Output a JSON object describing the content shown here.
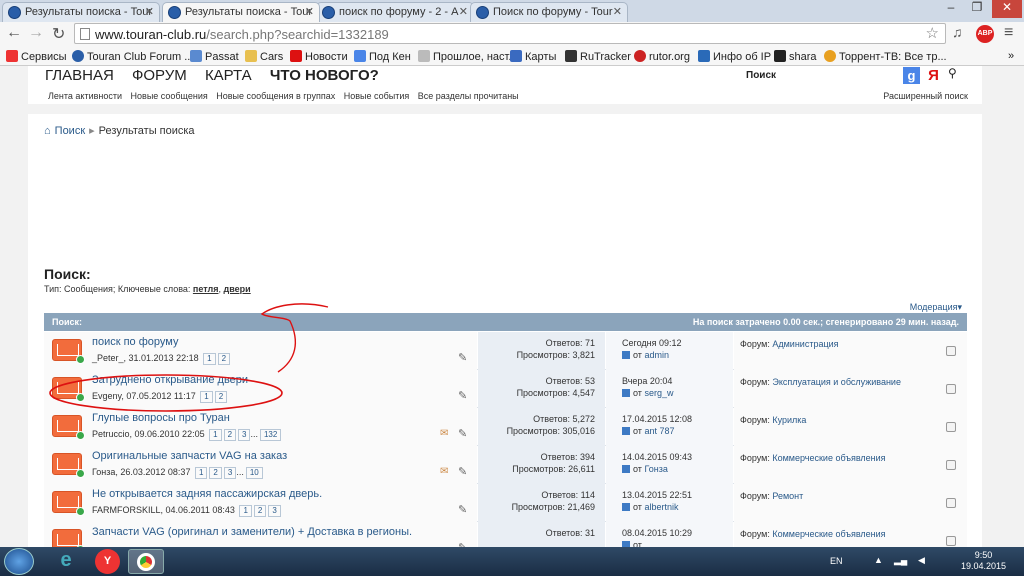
{
  "tabs": [
    {
      "title": "Результаты поиска - Tour"
    },
    {
      "title": "Результаты поиска - Tour"
    },
    {
      "title": "поиск по форуму - 2 - А"
    },
    {
      "title": "Поиск по форуму - Tour"
    }
  ],
  "address": {
    "host": "www.touran-club.ru",
    "path": "/search.php?searchid=1332189"
  },
  "bookmarks": [
    "Сервисы",
    "Touran Club Forum ...",
    "Passat",
    "Cars",
    "Новости",
    "Под Кен",
    "Прошлое, наст.",
    "Карты",
    "RuTracker",
    "rutor.org",
    "Инфо об IP",
    "shara",
    "Торрент-ТВ: Все тр..."
  ],
  "header": {
    "nav": [
      "ГЛАВНАЯ",
      "ФОРУМ",
      "КАРТА",
      "ЧТО НОВОГО?"
    ],
    "subnav": [
      "Лента активности",
      "Новые сообщения",
      "Новые сообщения в группах",
      "Новые события",
      "Все разделы прочитаны"
    ],
    "search_label": "Поиск",
    "advanced_search": "Расширенный поиск"
  },
  "breadcrumb": {
    "search": "Поиск",
    "current": "Результаты поиска"
  },
  "page": {
    "title": "Поиск:",
    "subtitle_prefix": "Тип: Сообщения; Ключевые слова:",
    "keyword1": "петля",
    "keyword2": "двери",
    "moderation": "Модерация",
    "table_title": "Поиск:",
    "table_info": "На поиск затрачено 0.00 сек.; сгенерировано 29 мин. назад."
  },
  "rows": [
    {
      "title": "поиск по форуму",
      "meta": "_Peter_, 31.01.2013 22:18",
      "pages": [
        "1",
        "2"
      ],
      "replies": "Ответов: 71",
      "views": "Просмотров: 3,821",
      "last_date": "Сегодня 09:12",
      "last_by": "admin",
      "forum": "Администрация"
    },
    {
      "title": "Затруднено открывание двери",
      "meta": "Evgeny, 07.05.2012 11:17",
      "pages": [
        "1",
        "2"
      ],
      "replies": "Ответов: 53",
      "views": "Просмотров: 4,547",
      "last_date": "Вчера 20:04",
      "last_by": "serg_w",
      "forum": "Эксплуатация и обслуживание"
    },
    {
      "title": "Глупые вопросы про Туран",
      "meta": "Petruccio, 09.06.2010 22:05",
      "pages": [
        "1",
        "2",
        "3",
        "...",
        "132"
      ],
      "replies": "Ответов: 5,272",
      "views": "Просмотров: 305,016",
      "last_date": "17.04.2015 12:08",
      "last_by": "ant 787",
      "forum": "Курилка"
    },
    {
      "title": "Оригинальные запчасти VAG на заказ",
      "meta": "Гонза, 26.03.2012 08:37",
      "pages": [
        "1",
        "2",
        "3",
        "...",
        "10"
      ],
      "replies": "Ответов: 394",
      "views": "Просмотров: 26,611",
      "last_date": "14.04.2015 09:43",
      "last_by": "Гонза",
      "forum": "Коммерческие объявления"
    },
    {
      "title": "Не открывается задняя пассажирская дверь.",
      "meta": "FARMFORSKILL, 04.06.2011 08:43",
      "pages": [
        "1",
        "2",
        "3"
      ],
      "replies": "Ответов: 114",
      "views": "Просмотров: 21,469",
      "last_date": "13.04.2015 22:51",
      "last_by": "albertnik",
      "forum": "Ремонт"
    },
    {
      "title": "Запчасти VAG (оригинал и заменители) + Доставка в регионы.",
      "meta": "",
      "pages": [],
      "replies": "Ответов: 31",
      "views": "",
      "last_date": "08.04.2015 10:29",
      "last_by": "",
      "forum": "Коммерческие объявления"
    }
  ],
  "forum_prefix": "Форум:",
  "by_prefix": "от",
  "taskbar": {
    "lang": "EN",
    "time": "9:50",
    "date": "19.04.2015"
  }
}
